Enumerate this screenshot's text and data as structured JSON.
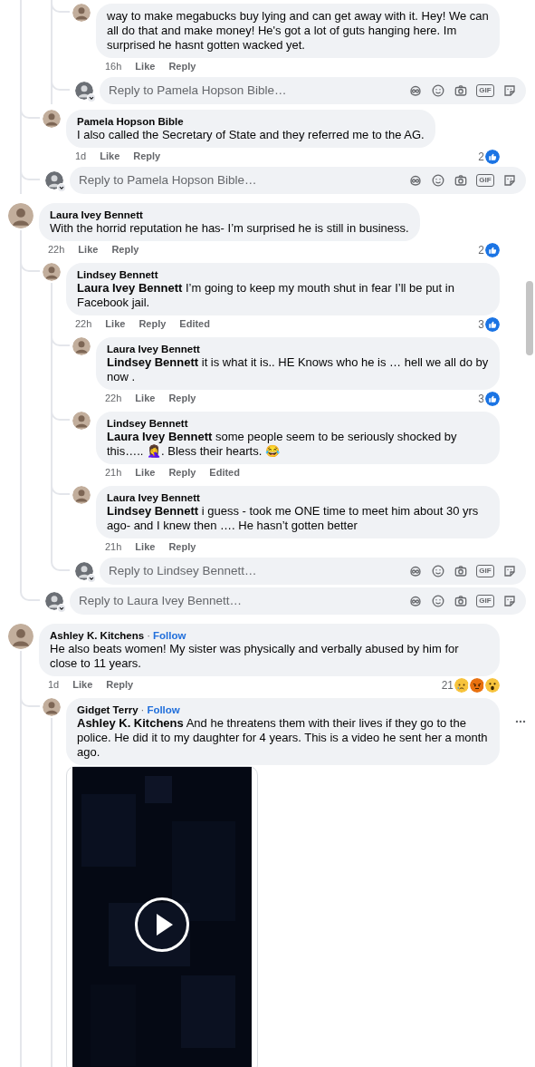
{
  "items": [
    {
      "kind": "thread",
      "children": [
        {
          "kind": "thread",
          "children": [
            {
              "kind": "comment",
              "text": "way to make megabucks buy lying and can get away with it. Hey! We can all do that and make money! He's got a lot of guts hanging here. Im surprised he hasnt gotten wacked yet.",
              "time": "16h",
              "actions": [
                "Like",
                "Reply"
              ]
            },
            {
              "kind": "reply_box",
              "placeholder": "Reply to Pamela Hopson Bible…",
              "gif": "GIF"
            }
          ]
        },
        {
          "kind": "comment",
          "author": "Pamela Hopson Bible",
          "text": "I also called the Secretary of State and they referred me to the AG.",
          "time": "1d",
          "actions": [
            "Like",
            "Reply"
          ],
          "reactions": {
            "count": "2",
            "icons": [
              {
                "kind": "like"
              }
            ]
          }
        },
        {
          "kind": "reply_box",
          "placeholder": "Reply to Pamela Hopson Bible…",
          "gif": "GIF"
        }
      ]
    },
    {
      "kind": "comment",
      "author": "Laura Ivey Bennett",
      "text": "With the horrid reputation he has- I’m surprised he is still in business.",
      "time": "22h",
      "actions": [
        "Like",
        "Reply"
      ],
      "reactions": {
        "count": "2",
        "icons": [
          {
            "kind": "like"
          }
        ]
      },
      "children": [
        {
          "kind": "comment",
          "author": "Lindsey Bennett",
          "text": "**Laura Ivey Bennett** I’m going to keep my mouth shut in fear I’ll be put in Facebook jail.",
          "time": "22h",
          "actions": [
            "Like",
            "Reply",
            "Edited"
          ],
          "reactions": {
            "count": "3",
            "icons": [
              {
                "kind": "like"
              }
            ]
          },
          "children": [
            {
              "kind": "comment",
              "author": "Laura Ivey Bennett",
              "text": "**Lindsey Bennett** it is what it is.. HE Knows who he is … hell we all do by now .",
              "time": "22h",
              "actions": [
                "Like",
                "Reply"
              ],
              "reactions": {
                "count": "3",
                "icons": [
                  {
                    "kind": "like"
                  }
                ]
              }
            },
            {
              "kind": "comment",
              "author": "Lindsey Bennett",
              "text": "**Laura Ivey Bennett** some people seem to be seriously shocked by this….. 🤦‍♀️. Bless their hearts. 😂",
              "time": "21h",
              "actions": [
                "Like",
                "Reply",
                "Edited"
              ]
            },
            {
              "kind": "comment",
              "author": "Laura Ivey Bennett",
              "text": "**Lindsey Bennett** i guess - took me ONE time to meet him about 30 yrs ago- and I knew then …. He hasn’t gotten better",
              "time": "21h",
              "actions": [
                "Like",
                "Reply"
              ]
            },
            {
              "kind": "reply_box",
              "placeholder": "Reply to Lindsey Bennett…",
              "gif": "GIF"
            }
          ]
        },
        {
          "kind": "reply_box",
          "placeholder": "Reply to Laura Ivey Bennett…",
          "gif": "GIF"
        }
      ]
    },
    {
      "kind": "comment",
      "author": "Ashley K. Kitchens",
      "follow_separator": "·",
      "follow": "Follow",
      "text": "He also beats women! My sister was physically and verbally abused by him for close to 11 years.",
      "time": "1d",
      "actions": [
        "Like",
        "Reply"
      ],
      "reactions": {
        "count": "21",
        "icons": [
          {
            "kind": "sad"
          },
          {
            "kind": "angry"
          },
          {
            "kind": "wow"
          }
        ]
      },
      "has_more_replies": true,
      "children": [
        {
          "kind": "comment",
          "author": "Gidget Terry",
          "follow_separator": "·",
          "follow": "Follow",
          "text": "**Ashley K. Kitchens** And he threatens them with their lives if they go to the police. He did it to my daughter for 4 years. This is a video he sent her a month ago.",
          "menu": true,
          "has_more_replies": true,
          "attachment": {
            "kind": "video"
          }
        }
      ]
    }
  ]
}
